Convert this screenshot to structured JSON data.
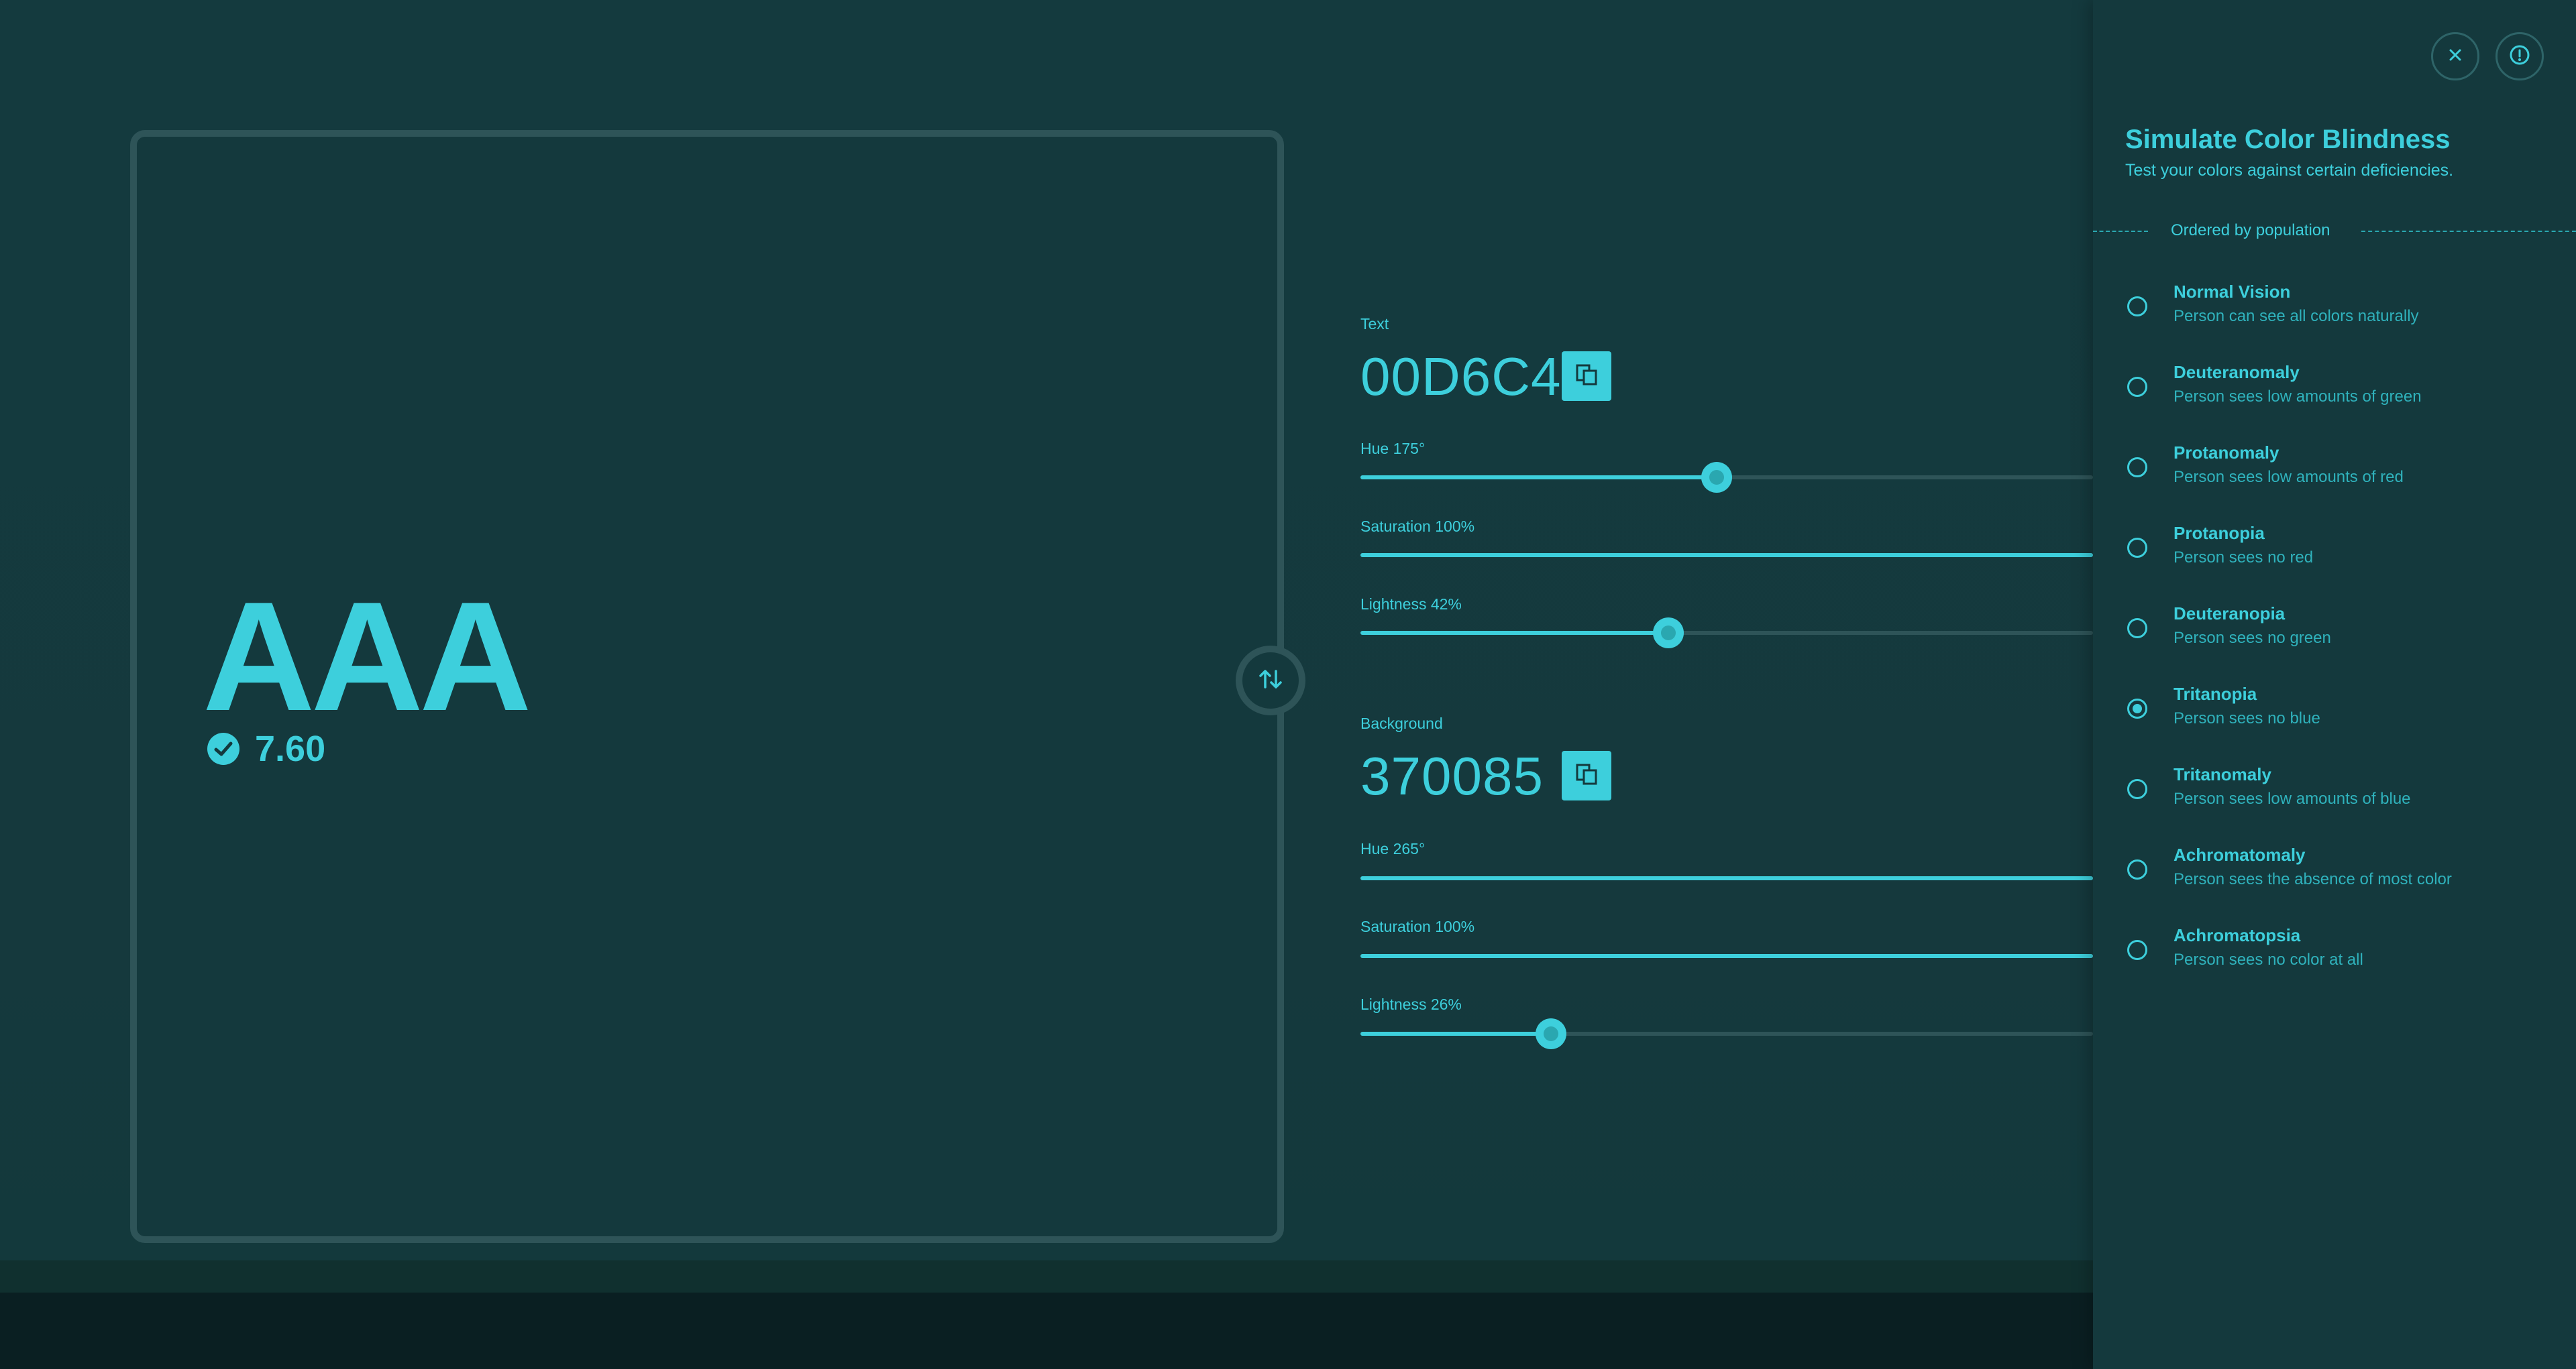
{
  "preview": {
    "sample_text": "AAA",
    "contrast_score": "7.60"
  },
  "text_color": {
    "label": "Text",
    "hex": "00D6C4",
    "hue": {
      "label": "Hue 175°",
      "fraction": 0.486
    },
    "saturation": {
      "label": "Saturation 100%",
      "fraction": 1.0
    },
    "lightness": {
      "label": "Lightness 42%",
      "fraction": 0.42
    }
  },
  "background_color": {
    "label": "Background",
    "hex": "370085",
    "hue": {
      "label": "Hue 265°",
      "fraction": 1.0
    },
    "saturation": {
      "label": "Saturation 100%",
      "fraction": 1.0
    },
    "lightness": {
      "label": "Lightness 26%",
      "fraction": 0.26
    }
  },
  "panel": {
    "title": "Simulate Color Blindness",
    "subtitle": "Test your colors against certain deficiencies.",
    "divider_text": "Ordered by population",
    "options": [
      {
        "name": "Normal Vision",
        "desc": "Person can see all colors naturally",
        "selected": false
      },
      {
        "name": "Deuteranomaly",
        "desc": "Person sees low amounts of green",
        "selected": false
      },
      {
        "name": "Protanomaly",
        "desc": "Person sees low amounts of red",
        "selected": false
      },
      {
        "name": "Protanopia",
        "desc": "Person sees no red",
        "selected": false
      },
      {
        "name": "Deuteranopia",
        "desc": "Person sees no green",
        "selected": false
      },
      {
        "name": "Tritanopia",
        "desc": "Person sees no blue",
        "selected": true
      },
      {
        "name": "Tritanomaly",
        "desc": "Person sees low amounts of blue",
        "selected": false
      },
      {
        "name": "Achromatomaly",
        "desc": "Person sees the absence of most color",
        "selected": false
      },
      {
        "name": "Achromatopsia",
        "desc": "Person sees no color at all",
        "selected": false
      }
    ]
  },
  "icons": {
    "close": "close-icon",
    "info": "info-icon",
    "copy": "copy-icon",
    "swap": "swap-icon",
    "check": "check-circle-icon"
  },
  "colors": {
    "accent": "#3DCFDC",
    "background": "#14393D",
    "track": "#2E5458"
  }
}
